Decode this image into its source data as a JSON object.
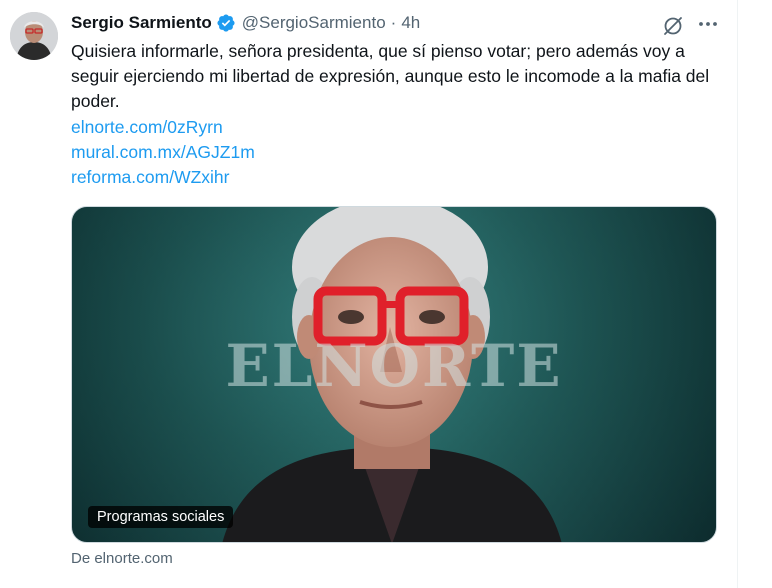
{
  "author": {
    "name": "Sergio Sarmiento",
    "handle": "@SergioSarmiento",
    "separator": "·",
    "time": "4h",
    "verified_badge_icon": "verified-badge-icon"
  },
  "tweet": {
    "text": "Quisiera informarle, señora presidenta, que sí pienso votar; pero además voy a seguir ejerciendo mi libertad de expresión, aunque esto le incomode a la mafia del poder.",
    "links": [
      "elnorte.com/0zRyrn",
      "mural.com.mx/AGJZ1m",
      "reforma.com/WZxihr"
    ]
  },
  "card": {
    "watermark": "ELNORTE",
    "label": "Programas sociales",
    "source": "De elnorte.com"
  },
  "actions": {
    "grok_icon": "grok-icon",
    "more_icon": "more-icon"
  },
  "colors": {
    "accent": "#1d9bf0",
    "text": "#0f1419",
    "secondary": "#536471",
    "card_background": "#1c5553",
    "glasses": "#e0202a"
  }
}
